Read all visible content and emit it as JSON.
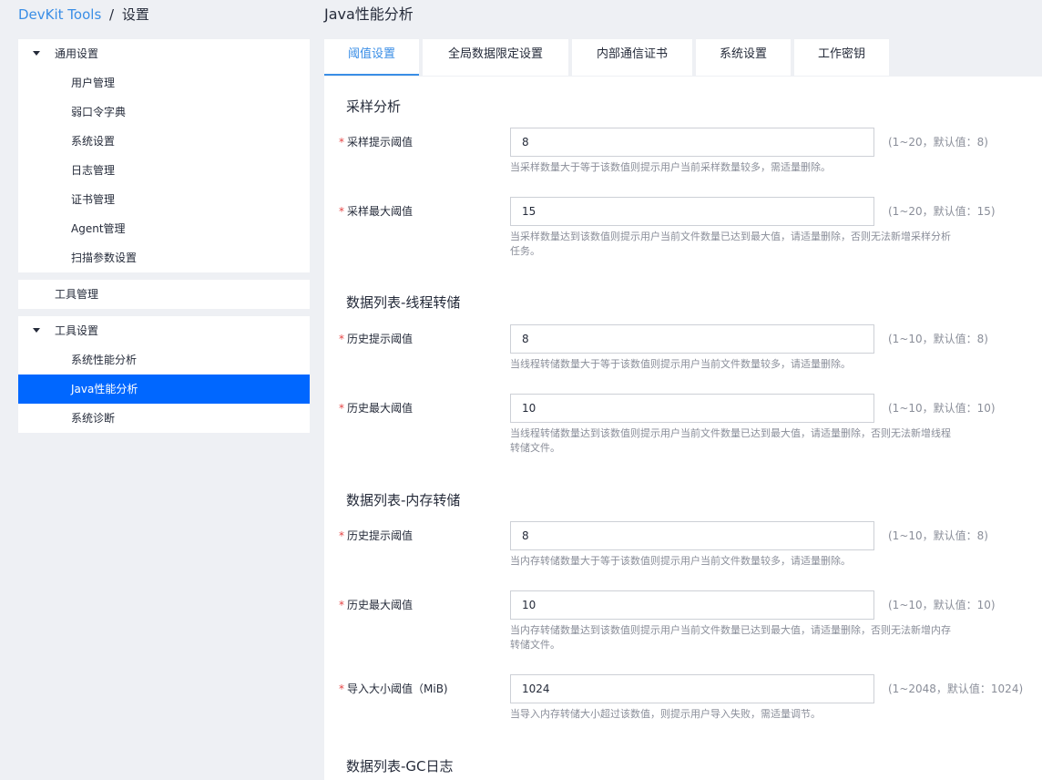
{
  "breadcrumb": {
    "root": "DevKit Tools",
    "sep": "/",
    "current": "设置"
  },
  "page_title": "Java性能分析",
  "sidebar": {
    "group1": {
      "label": "通用设置",
      "items": [
        "用户管理",
        "弱口令字典",
        "系统设置",
        "日志管理",
        "证书管理",
        "Agent管理",
        "扫描参数设置"
      ]
    },
    "group2": {
      "label": "工具管理"
    },
    "group3": {
      "label": "工具设置",
      "items": [
        "系统性能分析",
        "Java性能分析",
        "系统诊断"
      ],
      "active_index": 1
    }
  },
  "tabs": [
    "阈值设置",
    "全局数据限定设置",
    "内部通信证书",
    "系统设置",
    "工作密钥"
  ],
  "active_tab": 0,
  "sections": [
    {
      "title": "采样分析",
      "fields": [
        {
          "label": "采样提示阈值",
          "value": "8",
          "range": "(1~20，默认值：8)",
          "hint": "当采样数量大于等于该数值则提示用户当前采样数量较多，需适量删除。"
        },
        {
          "label": "采样最大阈值",
          "value": "15",
          "range": "(1~20，默认值：15)",
          "hint1": "当采样数量达到该数值则提示用户当前文件数量已达到最大值，请适量删除，否则无法新增采样分析",
          "hint2": "任务。"
        }
      ]
    },
    {
      "title": "数据列表-线程转储",
      "fields": [
        {
          "label": "历史提示阈值",
          "value": "8",
          "range": "(1~10，默认值：8)",
          "hint": "当线程转储数量大于等于该数值则提示用户当前文件数量较多，请适量删除。"
        },
        {
          "label": "历史最大阈值",
          "value": "10",
          "range": "(1~10，默认值：10)",
          "hint1": "当线程转储数量达到该数值则提示用户当前文件数量已达到最大值，请适量删除，否则无法新增线程",
          "hint2": "转储文件。"
        }
      ]
    },
    {
      "title": "数据列表-内存转储",
      "fields": [
        {
          "label": "历史提示阈值",
          "value": "8",
          "range": "(1~10，默认值：8)",
          "hint": "当内存转储数量大于等于该数值则提示用户当前文件数量较多，请适量删除。"
        },
        {
          "label": "历史最大阈值",
          "value": "10",
          "range": "(1~10，默认值：10)",
          "hint1": "当内存转储数量达到该数值则提示用户当前文件数量已达到最大值，请适量删除，否则无法新增内存",
          "hint2": "转储文件。"
        },
        {
          "label": "导入大小阈值（MiB)",
          "value": "1024",
          "range": "(1~2048，默认值：1024)",
          "hint": "当导入内存转储大小超过该数值，则提示用户导入失败，需适量调节。"
        }
      ]
    },
    {
      "title": "数据列表-GC日志"
    }
  ],
  "required_mark": "*",
  "colors": {
    "accent": "#3a8ee6",
    "active_nav": "#0067ff",
    "required": "#e54545",
    "muted": "#8a8e99"
  }
}
